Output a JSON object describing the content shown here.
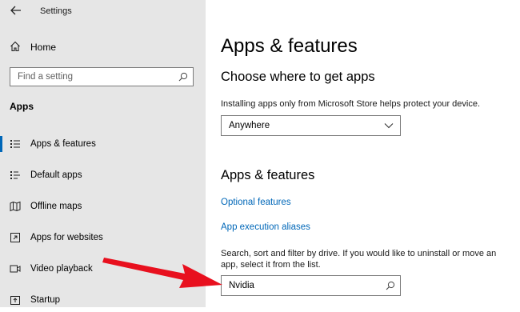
{
  "window": {
    "title": "Settings"
  },
  "sidebar": {
    "home_label": "Home",
    "search_placeholder": "Find a setting",
    "section_heading": "Apps",
    "items": [
      {
        "label": "Apps & features",
        "icon": "apps-features-icon",
        "selected": true
      },
      {
        "label": "Default apps",
        "icon": "default-apps-icon"
      },
      {
        "label": "Offline maps",
        "icon": "offline-maps-icon"
      },
      {
        "label": "Apps for websites",
        "icon": "apps-for-websites-icon"
      },
      {
        "label": "Video playback",
        "icon": "video-playback-icon"
      },
      {
        "label": "Startup",
        "icon": "startup-icon"
      }
    ]
  },
  "main": {
    "title": "Apps & features",
    "choose": {
      "heading": "Choose where to get apps",
      "description": "Installing apps only from Microsoft Store helps protect your device.",
      "dropdown_value": "Anywhere"
    },
    "apps_features": {
      "heading": "Apps & features",
      "optional_features_link": "Optional features",
      "execution_aliases_link": "App execution aliases",
      "search_description_line1": "Search, sort and filter by drive. If you would like to uninstall or move an",
      "search_description_line2": "app, select it from the list.",
      "search_value": "Nvidia"
    }
  },
  "colors": {
    "accent": "#0067b8",
    "sidebar_bg": "#e6e6e6",
    "annotation_arrow": "#e8101e"
  }
}
